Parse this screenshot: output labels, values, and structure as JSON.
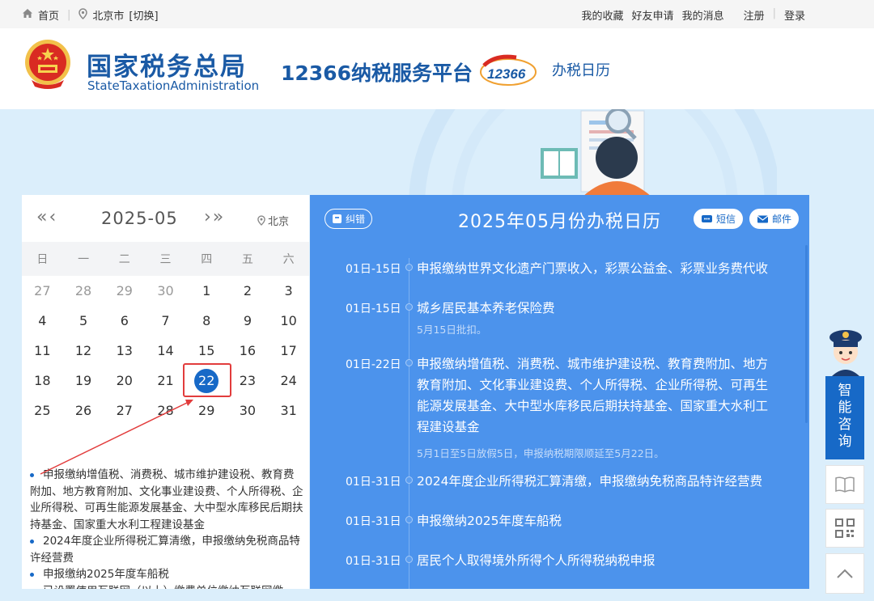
{
  "topbar": {
    "home": "首页",
    "city": "北京市",
    "switch": "[切换]",
    "links": [
      "我的收藏",
      "好友申请",
      "我的消息"
    ],
    "register": "注册",
    "login": "登录"
  },
  "header": {
    "brand_cn": "国家税务总局",
    "brand_en": "StateTaxationAdministration",
    "platform": "12366纳税服务平台",
    "page_name": "办税日历",
    "logo_text": "12366"
  },
  "calendar": {
    "month": "2025-05",
    "location": "北京",
    "weekdays": [
      "日",
      "一",
      "二",
      "三",
      "四",
      "五",
      "六"
    ],
    "selected_day": "22",
    "days": [
      {
        "d": "27",
        "m": true
      },
      {
        "d": "28",
        "m": true
      },
      {
        "d": "29",
        "m": true
      },
      {
        "d": "30",
        "m": true
      },
      {
        "d": "1"
      },
      {
        "d": "2"
      },
      {
        "d": "3"
      },
      {
        "d": "4"
      },
      {
        "d": "5"
      },
      {
        "d": "6"
      },
      {
        "d": "7"
      },
      {
        "d": "8"
      },
      {
        "d": "9"
      },
      {
        "d": "10"
      },
      {
        "d": "11"
      },
      {
        "d": "12"
      },
      {
        "d": "13"
      },
      {
        "d": "14"
      },
      {
        "d": "15"
      },
      {
        "d": "16"
      },
      {
        "d": "17"
      },
      {
        "d": "18"
      },
      {
        "d": "19"
      },
      {
        "d": "20"
      },
      {
        "d": "21"
      },
      {
        "d": "22",
        "s": true
      },
      {
        "d": "23"
      },
      {
        "d": "24"
      },
      {
        "d": "25"
      },
      {
        "d": "26"
      },
      {
        "d": "27"
      },
      {
        "d": "28"
      },
      {
        "d": "29"
      },
      {
        "d": "30"
      },
      {
        "d": "31"
      }
    ],
    "items": [
      "申报缴纳增值税、消费税、城市维护建设税、教育费附加、地方教育附加、文化事业建设费、个人所得税、企业所得税、可再生能源发展基金、大中型水库移民后期扶持基金、国家重大水利工程建设基金",
      "2024年度企业所得税汇算清缴，申报缴纳免税商品特许经营费",
      "申报缴纳2025年度车船税",
      "已设置使用互联网（以上）缴费单位缴纳互联网缴"
    ]
  },
  "tax_panel": {
    "title": "2025年05月份办税日历",
    "correct_btn": "纠错",
    "sms_btn": "短信",
    "mail_btn": "邮件",
    "entries": [
      {
        "date": "01日-15日",
        "text": "申报缴纳世界文化遗产门票收入，彩票公益金、彩票业务费代收",
        "note": ""
      },
      {
        "date": "01日-15日",
        "text": "城乡居民基本养老保险费",
        "note": "5月15日批扣。"
      },
      {
        "date": "01日-22日",
        "text": "申报缴纳增值税、消费税、城市维护建设税、教育费附加、地方教育附加、文化事业建设费、个人所得税、企业所得税、可再生能源发展基金、大中型水库移民后期扶持基金、国家重大水利工程建设基金",
        "note": "5月1日至5日放假5日，申报纳税期限顺延至5月22日。"
      },
      {
        "date": "01日-31日",
        "text": "2024年度企业所得税汇算清缴，申报缴纳免税商品特许经营费",
        "note": ""
      },
      {
        "date": "01日-31日",
        "text": "申报缴纳2025年度车船税",
        "note": ""
      },
      {
        "date": "01日-31日",
        "text": "居民个人取得境外所得个人所得税纳税申报",
        "note": ""
      }
    ]
  },
  "side_tools": {
    "smart_consult": "智能咨询"
  },
  "colors": {
    "brand_blue": "#1a5aa5",
    "panel_blue": "#4c93ec",
    "selected_blue": "#1769c7",
    "highlight_red": "#e23c3c"
  }
}
